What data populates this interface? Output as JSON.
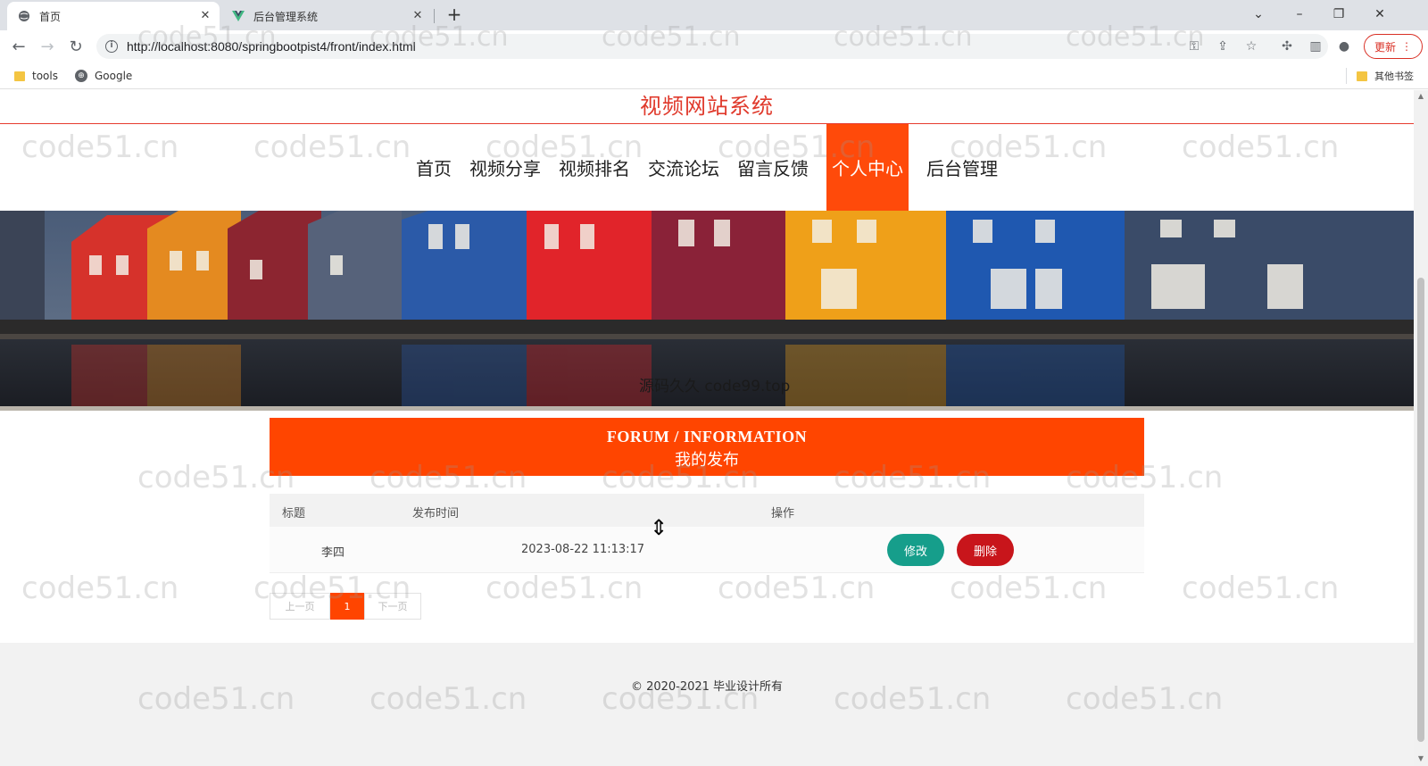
{
  "browser": {
    "tabs": [
      {
        "title": "首页",
        "active": true
      },
      {
        "title": "后台管理系统",
        "active": false
      }
    ],
    "url": "http://localhost:8080/springbootpist4/front/index.html",
    "update_label": "更新",
    "bookmarks": [
      {
        "label": "tools",
        "icon": "folder-icon"
      },
      {
        "label": "Google",
        "icon": "globe-icon"
      }
    ],
    "other_bookmarks": "其他书签"
  },
  "site": {
    "title": "视频网站系统",
    "nav": [
      {
        "label": "首页",
        "active": false
      },
      {
        "label": "视频分享",
        "active": false
      },
      {
        "label": "视频排名",
        "active": false
      },
      {
        "label": "交流论坛",
        "active": false
      },
      {
        "label": "留言反馈",
        "active": false
      },
      {
        "label": "个人中心",
        "active": true
      },
      {
        "label": "后台管理",
        "active": false
      }
    ],
    "banner_caption": "源码久久 code99.top"
  },
  "section": {
    "en": "FORUM / INFORMATION",
    "zh": "我的发布"
  },
  "table": {
    "headers": [
      "标题",
      "发布时间",
      "操作"
    ],
    "rows": [
      {
        "title": "李四",
        "time": "2023-08-22 11:13:17",
        "edit": "修改",
        "delete": "删除"
      }
    ]
  },
  "pager": {
    "prev": "上一页",
    "current": "1",
    "next": "下一页"
  },
  "footer": {
    "text": "© 2020-2021 毕业设计所有"
  },
  "watermark": "code51.cn",
  "colors": {
    "accent": "#ff4500",
    "title": "#e03a2c",
    "edit": "#169e8b",
    "delete": "#c8151b"
  }
}
